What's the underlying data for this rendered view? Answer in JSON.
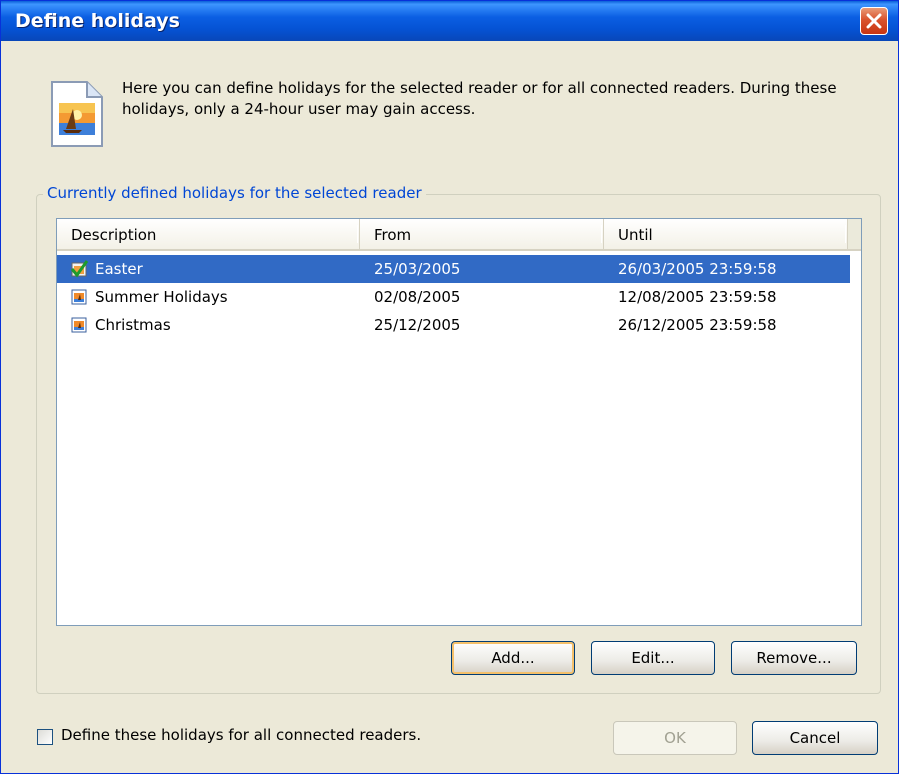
{
  "window": {
    "title": "Define holidays",
    "close_icon": "close-icon"
  },
  "intro": {
    "icon": "holiday-document-icon",
    "text": "Here you can define holidays for the selected reader or for all connected readers. During these holidays, only a 24-hour user may gain access."
  },
  "group": {
    "legend": "Currently defined holidays for the selected reader"
  },
  "list": {
    "columns": [
      "Description",
      "From",
      "Until"
    ],
    "rows": [
      {
        "description": "Easter",
        "from": "25/03/2005",
        "until": "26/03/2005 23:59:58",
        "icon": "active-holiday-check-icon",
        "selected": true
      },
      {
        "description": "Summer Holidays",
        "from": "02/08/2005",
        "until": "12/08/2005 23:59:58",
        "icon": "holiday-icon",
        "selected": false
      },
      {
        "description": "Christmas",
        "from": "25/12/2005",
        "until": "26/12/2005 23:59:58",
        "icon": "holiday-icon",
        "selected": false
      }
    ]
  },
  "buttons": {
    "add": "Add...",
    "edit": "Edit...",
    "remove": "Remove...",
    "ok": "OK",
    "cancel": "Cancel"
  },
  "footer": {
    "checkbox_label": "Define these holidays for all connected readers.",
    "checkbox_checked": false
  },
  "colors": {
    "title_bar": "#0553d4",
    "selection": "#316ac5",
    "group_legend": "#0046d5",
    "dialog_bg": "#ece9d8"
  }
}
